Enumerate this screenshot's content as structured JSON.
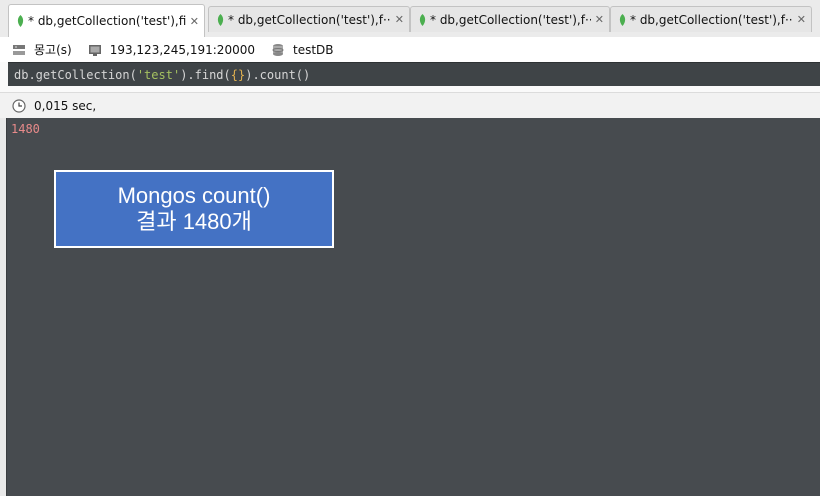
{
  "tabs": [
    {
      "label": "* db,getCollection('test'),fi···",
      "active": true
    },
    {
      "label": "* db,getCollection('test'),f···",
      "active": false
    },
    {
      "label": "* db,getCollection('test'),f···",
      "active": false
    },
    {
      "label": "* db,getCollection('test'),f···",
      "active": false
    }
  ],
  "info": {
    "mode_label": "몽고(s)",
    "server": "193,123,245,191:20000",
    "database": "testDB"
  },
  "query": {
    "prefix": "db.getCollection(",
    "string": "'test'",
    "mid": ").find(",
    "braces": "{}",
    "suffix": ").count()"
  },
  "status": {
    "elapsed": "0,015 sec,"
  },
  "result": {
    "value": "1480"
  },
  "callout": {
    "line1": "Mongos count()",
    "line2": "결과 1480개"
  },
  "colors": {
    "leaf": "#4caf50",
    "result_bg": "#474b4f",
    "callout_bg": "#4472c4",
    "result_text": "#e88a8a"
  }
}
